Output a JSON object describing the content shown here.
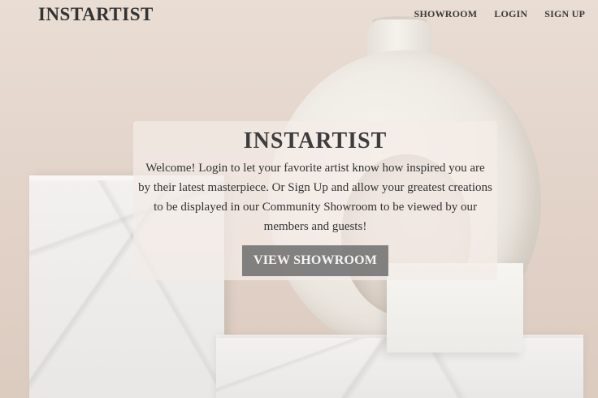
{
  "nav": {
    "brand": "INSTARTIST",
    "links": [
      {
        "label": "SHOWROOM"
      },
      {
        "label": "LOGIN"
      },
      {
        "label": "SIGN UP"
      }
    ]
  },
  "hero": {
    "title": "INSTARTIST",
    "text": "Welcome! Login to let your favorite artist know how inspired you are by their latest masterpiece. Or Sign Up and allow your greatest creations to be displayed in our Community Showroom to be viewed by our members and guests!",
    "button_label": "VIEW SHOWROOM"
  },
  "colors": {
    "text": "#333333",
    "button_bg": "#6e6e6e",
    "panel_bg": "#f4ece8"
  }
}
